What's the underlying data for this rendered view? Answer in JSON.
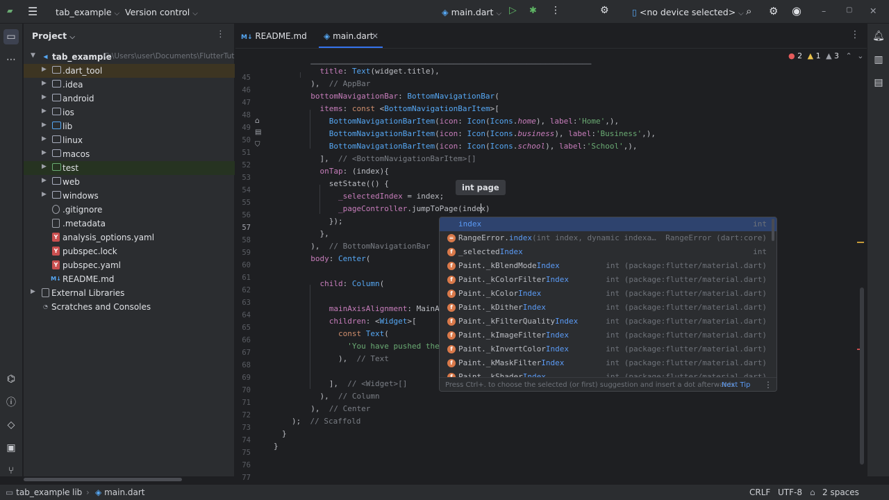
{
  "titlebar": {
    "project_name": "tab_example",
    "vcs_label": "Version control",
    "run_config": "main.dart",
    "device": "<no device selected>"
  },
  "project_panel": {
    "title": "Project",
    "items": [
      {
        "label": "tab_example",
        "path": "C:\\Users\\user\\Documents\\FlutterTut"
      },
      {
        "label": ".dart_tool"
      },
      {
        "label": ".idea"
      },
      {
        "label": "android"
      },
      {
        "label": "ios"
      },
      {
        "label": "lib"
      },
      {
        "label": "linux"
      },
      {
        "label": "macos"
      },
      {
        "label": "test"
      },
      {
        "label": "web"
      },
      {
        "label": "windows"
      },
      {
        "label": ".gitignore"
      },
      {
        "label": ".metadata"
      },
      {
        "label": "analysis_options.yaml"
      },
      {
        "label": "pubspec.lock"
      },
      {
        "label": "pubspec.yaml"
      },
      {
        "label": "README.md"
      },
      {
        "label": "External Libraries"
      },
      {
        "label": "Scratches and Consoles"
      }
    ]
  },
  "tabs": [
    {
      "label": "README.md",
      "icon": "M↓"
    },
    {
      "label": "main.dart",
      "active": true
    }
  ],
  "inspections": {
    "errors": "2",
    "warnings": "1",
    "weak": "3"
  },
  "tooltip": "int page",
  "line_numbers": [
    "45",
    "46",
    "47",
    "48",
    "49",
    "50",
    "51",
    "52",
    "53",
    "54",
    "55",
    "56",
    "57",
    "58",
    "59",
    "60",
    "61",
    "62",
    "63",
    "64",
    "65",
    "66",
    "67",
    "68",
    "69",
    "70",
    "71",
    "72",
    "73",
    "74",
    "75",
    "76",
    "77"
  ],
  "completion": {
    "items": [
      {
        "prefix": "",
        "match": "index",
        "suffix": "",
        "type": "int",
        "icon": "none"
      },
      {
        "prefix": "RangeError.",
        "match": "index",
        "suffix": "(int index, dynamic indexa…",
        "type": "RangeError (dart:core)",
        "icon": "method"
      },
      {
        "prefix": "_selected",
        "match": "Index",
        "suffix": "",
        "type": "int",
        "icon": "field"
      },
      {
        "prefix": "Paint._kBlendMode",
        "match": "Index",
        "suffix": "",
        "type": "int (package:flutter/material.dart)",
        "icon": "field"
      },
      {
        "prefix": "Paint._kColorFilter",
        "match": "Index",
        "suffix": "",
        "type": "int (package:flutter/material.dart)",
        "icon": "field"
      },
      {
        "prefix": "Paint._kColor",
        "match": "Index",
        "suffix": "",
        "type": "int (package:flutter/material.dart)",
        "icon": "field"
      },
      {
        "prefix": "Paint._kDither",
        "match": "Index",
        "suffix": "",
        "type": "int (package:flutter/material.dart)",
        "icon": "field"
      },
      {
        "prefix": "Paint._kFilterQuality",
        "match": "Index",
        "suffix": "",
        "type": "int (package:flutter/material.dart)",
        "icon": "field"
      },
      {
        "prefix": "Paint._kImageFilter",
        "match": "Index",
        "suffix": "",
        "type": "int (package:flutter/material.dart)",
        "icon": "field"
      },
      {
        "prefix": "Paint._kInvertColor",
        "match": "Index",
        "suffix": "",
        "type": "int (package:flutter/material.dart)",
        "icon": "field"
      },
      {
        "prefix": "Paint._kMaskFilter",
        "match": "Index",
        "suffix": "",
        "type": "int (package:flutter/material.dart)",
        "icon": "field"
      },
      {
        "prefix": "Paint._kShader",
        "match": "Index",
        "suffix": "",
        "type": "int (package:flutter/material.dart)",
        "icon": "field"
      }
    ],
    "footer_hint": "Press Ctrl+. to choose the selected (or first) suggestion and insert a dot afterwards",
    "footer_link": "Next Tip"
  },
  "statusbar": {
    "crumbs": [
      "tab_example",
      "lib",
      "main.dart"
    ],
    "line_sep": "CRLF",
    "encoding": "UTF-8",
    "indent": "2 spaces"
  },
  "colors": {
    "accent": "#3574f0",
    "selection": "#2e436e",
    "keyword": "#cf8e6d",
    "class": "#56a8f5",
    "string": "#6aab73"
  }
}
